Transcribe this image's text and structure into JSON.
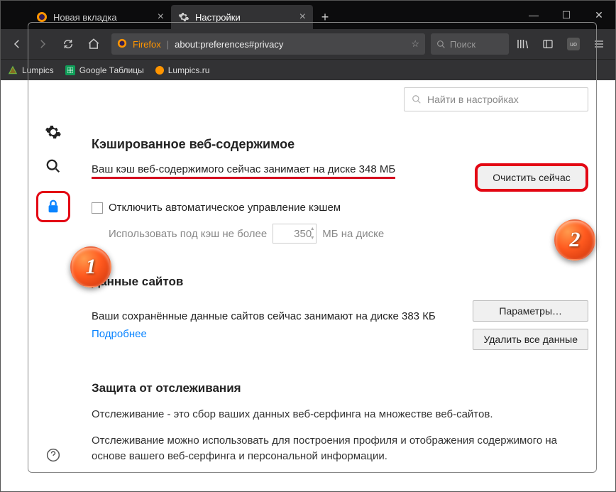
{
  "tabs": [
    {
      "label": "Новая вкладка",
      "active": false
    },
    {
      "label": "Настройки",
      "active": true
    }
  ],
  "url": {
    "brand": "Firefox",
    "path": "about:preferences#privacy"
  },
  "searchPlaceholder": "Поиск",
  "bookmarks": [
    {
      "label": "Lumpics"
    },
    {
      "label": "Google Таблицы"
    },
    {
      "label": "Lumpics.ru"
    }
  ],
  "prefsSearchPlaceholder": "Найти в настройках",
  "cache": {
    "heading": "Кэшированное веб-содержимое",
    "status": "Ваш кэш веб-содержимого сейчас занимает на диске 348 МБ",
    "clearBtn": "Очистить сейчас",
    "disableAuto": "Отключить автоматическое управление кэшем",
    "limitPrefix": "Использовать под кэш не более",
    "limitValue": "350",
    "limitSuffix": "МБ на диске"
  },
  "sitedata": {
    "heading": "Данные сайтов",
    "status": "Ваши сохранённые данные сайтов сейчас занимают на диске 383 КБ",
    "more": "Подробнее",
    "paramsBtn": "Параметры…",
    "deleteBtn": "Удалить все данные"
  },
  "tracking": {
    "heading": "Защита от отслеживания",
    "p1": "Отслеживание - это сбор ваших данных веб-серфинга на множестве веб-сайтов.",
    "p2": "Отслеживание можно использовать для построения профиля и отображения содержимого на основе вашего веб-серфинга и персональной информации."
  },
  "annotations": {
    "a1": "1",
    "a2": "2"
  }
}
